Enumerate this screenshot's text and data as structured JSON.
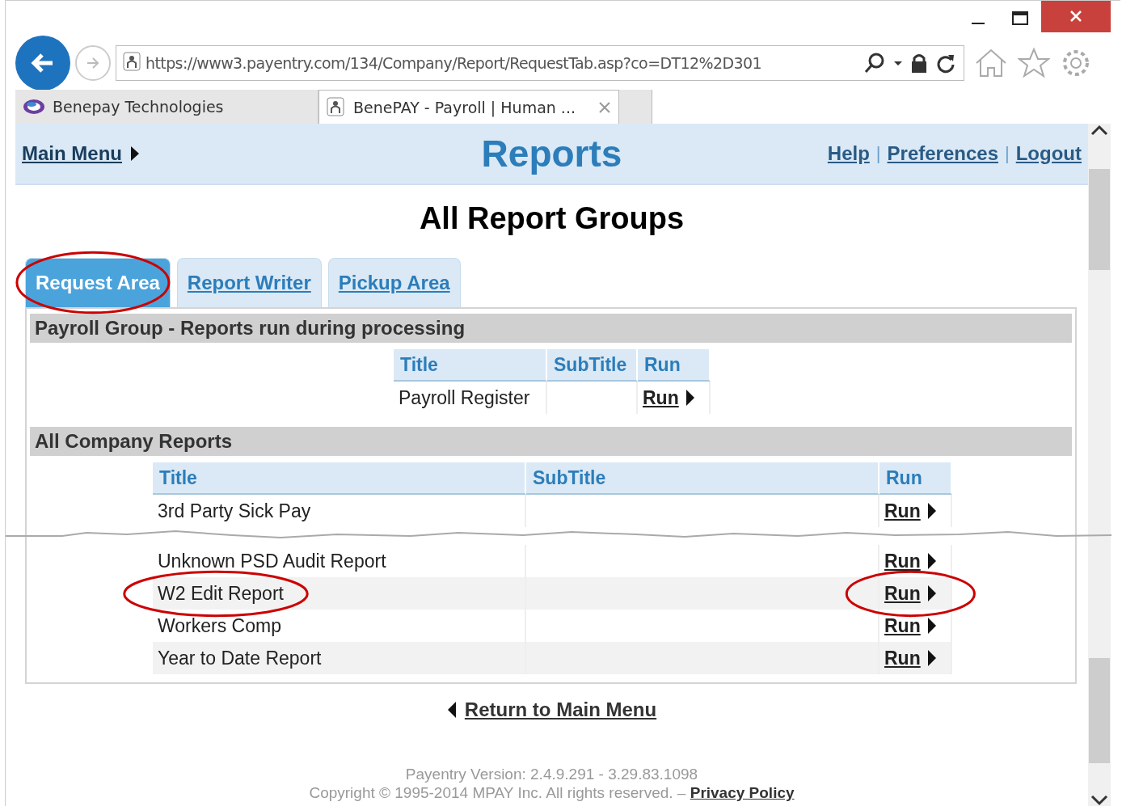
{
  "browser": {
    "url": "https://www3.payentry.com/134/Company/Report/RequestTab.asp?co=DT12%2D301",
    "tabs": [
      {
        "label": "Benepay Technologies",
        "selected": false
      },
      {
        "label": "BenePAY - Payroll | Human ...",
        "selected": true
      }
    ]
  },
  "header": {
    "left_link": "Main Menu",
    "title": "Reports",
    "links": [
      "Help",
      "Preferences",
      "Logout"
    ],
    "separator": "|"
  },
  "heading": "All Report Groups",
  "tabs": [
    {
      "label": "Request Area",
      "selected": true,
      "circled": true
    },
    {
      "label": "Report Writer",
      "selected": false,
      "circled": false
    },
    {
      "label": "Pickup Area",
      "selected": false,
      "circled": false
    }
  ],
  "groups": [
    {
      "title": "Payroll Group - Reports run during processing",
      "columns": [
        "Title",
        "SubTitle",
        "Run"
      ],
      "rows": [
        {
          "kind": "report",
          "title": "Payroll Register",
          "run": "Run",
          "title_circled": false,
          "run_circled": false
        }
      ]
    },
    {
      "title": "All Company Reports",
      "columns": [
        "Title",
        "SubTitle",
        "Run"
      ],
      "rows": [
        {
          "kind": "report",
          "title": "3rd Party Sick Pay",
          "run": "Run",
          "title_circled": false,
          "run_circled": false
        },
        {
          "kind": "tear"
        },
        {
          "kind": "report",
          "title": "Unknown PSD Audit Report",
          "run": "Run",
          "title_circled": false,
          "run_circled": false
        },
        {
          "kind": "report",
          "title": "W2 Edit Report",
          "run": "Run",
          "title_circled": true,
          "run_circled": true
        },
        {
          "kind": "report",
          "title": "Workers Comp",
          "run": "Run",
          "title_circled": false,
          "run_circled": false
        },
        {
          "kind": "report",
          "title": "Year to Date Report",
          "run": "Run",
          "title_circled": false,
          "run_circled": false
        }
      ]
    }
  ],
  "return_link": "Return to Main Menu",
  "footer": {
    "version": "Payentry Version: 2.4.9.291 - 3.29.83.1098",
    "copyright": "Copyright © 1995-2014 MPAY Inc. All rights reserved. –",
    "privacy": "Privacy Policy"
  }
}
